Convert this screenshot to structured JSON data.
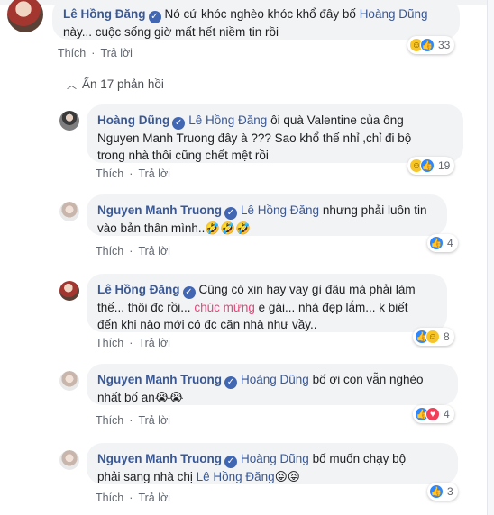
{
  "labels": {
    "like": "Thích",
    "reply": "Trả lời",
    "hide_replies": "Ẩn 17 phản hồi"
  },
  "icons": {
    "like": "like-icon",
    "haha": "haha-icon",
    "love": "love-icon",
    "verified": "verified-badge-icon",
    "chevron": "chevron-up-icon"
  },
  "colors": {
    "name": "#385898",
    "bubble": "#f2f3f5",
    "like": "#2d88ff",
    "haha": "#f7c528",
    "love": "#f33e58",
    "highlight": "#e9467a"
  },
  "comments": [
    {
      "author": "Lê Hồng Đăng",
      "text_line1": "Nó cứ khóc nghèo khóc khổ đây bố",
      "mention": "Hoàng Dũng",
      "text_line2": "này... cuộc sống giờ mất hết niềm tin rồi",
      "reactions": "33"
    },
    {
      "author": "Hoàng Dũng",
      "mention": "Lê Hồng Đăng",
      "text_line1": "ôi quà Valentine của ông",
      "text_line2": "Nguyen Manh Truong đây à ??? Sao khổ thế nhỉ ,chỉ đi bộ",
      "text_line3": "trong nhà thôi cũng chết mệt rồi",
      "reactions": "19"
    },
    {
      "author": "Nguyen Manh Truong",
      "mention": "Lê Hồng Đăng",
      "text_line1": "nhưng phải luôn tin",
      "text_line2": "vào bản thân mình..🤣🤣🤣",
      "reactions": "4"
    },
    {
      "author": "Lê Hồng Đăng",
      "text_line1": "Cũng có xin hay vay gì đâu mà phải làm",
      "text_line2a": "thế... thôi đc rồi...",
      "highlight": "chúc mừng",
      "text_line2b": "e gái... nhà đẹp lắm... k biết",
      "text_line3": "đến khi nào mới có đc căn nhà như vầy..",
      "reactions": "8"
    },
    {
      "author": "Nguyen Manh Truong",
      "mention": "Hoàng Dũng",
      "text_line1": "bố ơi con vẫn nghèo",
      "text_line2": "nhất bố an😭😭",
      "reactions": "4"
    },
    {
      "author": "Nguyen Manh Truong",
      "mention": "Hoàng Dũng",
      "text_line1": "bố muốn chạy bộ",
      "text_line2a": "phải sang nhà chị",
      "mention2": "Lê Hồng Đăng",
      "text_line2b": "😝😝",
      "reactions": "3"
    }
  ]
}
